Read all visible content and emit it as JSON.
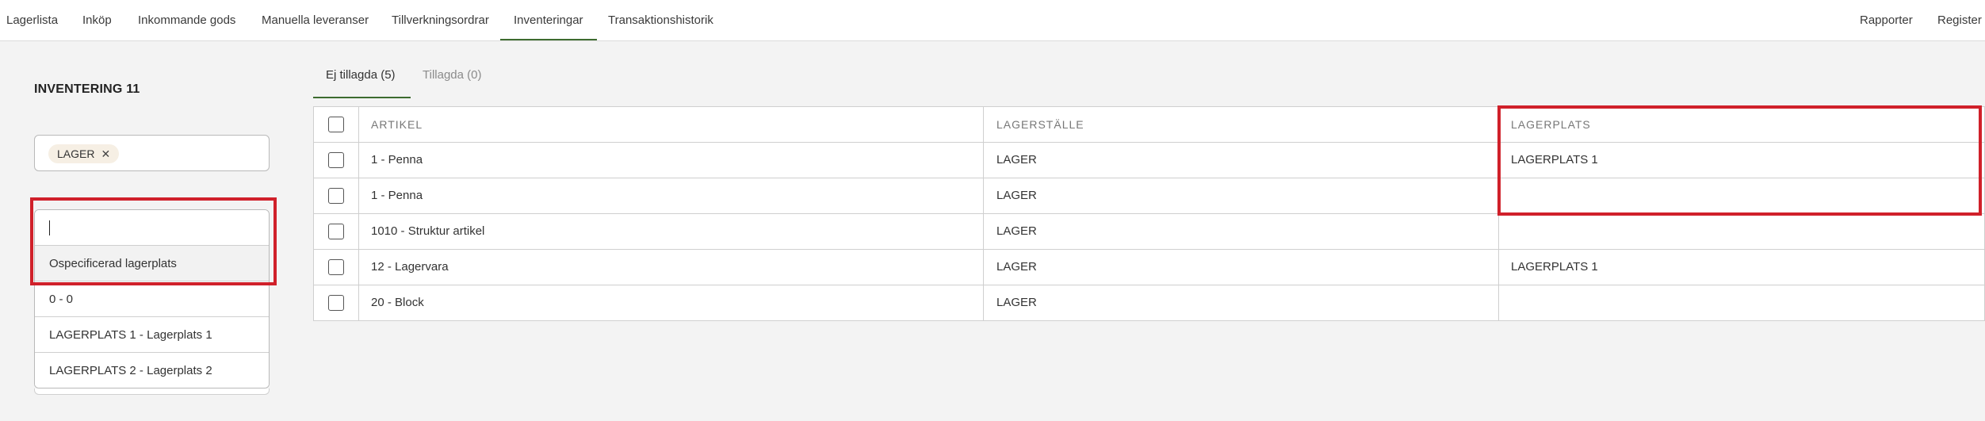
{
  "nav": {
    "items": [
      {
        "label": "Lagerlista"
      },
      {
        "label": "Inköp"
      },
      {
        "label": "Inkommande gods"
      },
      {
        "label": "Manuella leveranser"
      },
      {
        "label": "Tillverkningsordrar"
      },
      {
        "label": "Inventeringar",
        "active": true
      },
      {
        "label": "Transaktionshistorik"
      }
    ],
    "right": [
      {
        "label": "Rapporter"
      },
      {
        "label": "Register"
      }
    ]
  },
  "page": {
    "title": "INVENTERING 11"
  },
  "filter": {
    "chip_label": "LAGER",
    "chip_remove_glyph": "✕"
  },
  "dropdown": {
    "search_value": "",
    "options": [
      {
        "label": "Ospecificerad lagerplats",
        "highlighted": true
      },
      {
        "label": "0 - 0"
      },
      {
        "label": "LAGERPLATS 1 - Lagerplats 1"
      },
      {
        "label": "LAGERPLATS 2 - Lagerplats 2"
      }
    ]
  },
  "tabs": [
    {
      "label": "Ej tillagda (5)",
      "active": true
    },
    {
      "label": "Tillagda (0)",
      "active": false
    }
  ],
  "table": {
    "columns": [
      "ARTIKEL",
      "LAGERSTÄLLE",
      "LAGERPLATS"
    ],
    "rows": [
      {
        "artikel": "1 - Penna",
        "lagerstalle": "LAGER",
        "lagerplats": "LAGERPLATS 1"
      },
      {
        "artikel": "1 - Penna",
        "lagerstalle": "LAGER",
        "lagerplats": ""
      },
      {
        "artikel": "1010 - Struktur artikel",
        "lagerstalle": "LAGER",
        "lagerplats": ""
      },
      {
        "artikel": "12 - Lagervara",
        "lagerstalle": "LAGER",
        "lagerplats": "LAGERPLATS 1"
      },
      {
        "artikel": "20 - Block",
        "lagerstalle": "LAGER",
        "lagerplats": ""
      }
    ]
  },
  "colors": {
    "accent_green": "#3d6b2f",
    "highlight_red": "#d0202a",
    "chip_bg": "#f6efe4",
    "page_bg": "#f3f3f3"
  }
}
